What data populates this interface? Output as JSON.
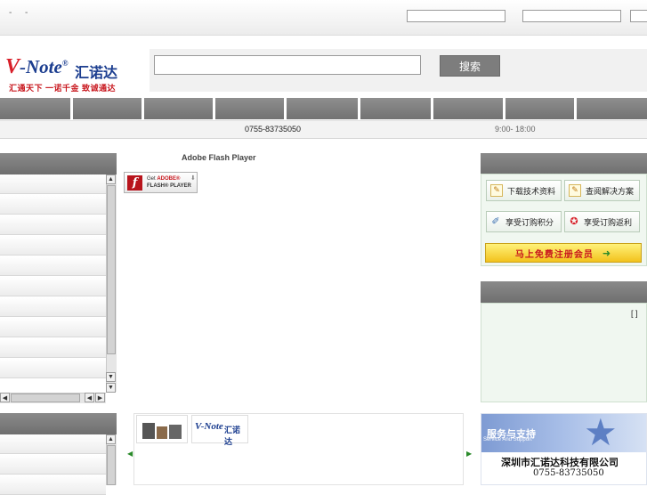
{
  "topbar": {
    "dash1": "-",
    "dash2": "-"
  },
  "header": {
    "logo": {
      "brand_prefix": "V",
      "brand_suffix": "-Note",
      "registered": "®",
      "cn_name": "汇诺达",
      "slogan": "汇通天下 一诺千金 致诚通达"
    },
    "search": {
      "button_label": "搜索"
    }
  },
  "nav": {
    "items": [
      "",
      "",
      "",
      "",
      "",
      "",
      "",
      "",
      ""
    ]
  },
  "infobar": {
    "phone": "0755-83735050",
    "hours": "9:00- 18:00"
  },
  "center": {
    "flash_title": "Adobe Flash Player",
    "flash_badge_line1_a": "Get ",
    "flash_badge_line1_b": "ADOBE®",
    "flash_badge_line2": "FLASH® PLAYER"
  },
  "right": {
    "buttons": [
      {
        "label": "下载技术资料",
        "icon": "document-pencil-icon"
      },
      {
        "label": "查阅解决方案",
        "icon": "document-pencil-icon"
      },
      {
        "label": "享受订购积分",
        "icon": "pen-icon"
      },
      {
        "label": "享受订购返利",
        "icon": "medal-icon"
      }
    ],
    "register_label": "马上免费注册会员",
    "bracket": "[ ]"
  },
  "service": {
    "title": "服务与支持",
    "subtitle": "Service And Support",
    "company": "深圳市汇诺达科技有限公司",
    "tel": "0755-83735050"
  },
  "strip": {
    "logo2_brand": "V-Note",
    "logo2_cn": "汇诺达"
  },
  "colors": {
    "nav_gray": "#7d7d7d",
    "accent_red": "#c8161d",
    "brand_blue": "#1b3d8f",
    "panel_green": "#f0f7f0"
  }
}
